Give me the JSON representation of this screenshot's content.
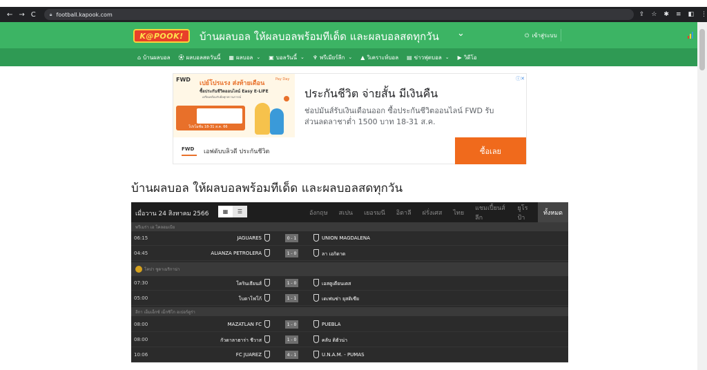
{
  "browser": {
    "url": "football.kapook.com"
  },
  "header": {
    "logo_text": "K@POOK!",
    "title": "บ้านผลบอล ให้ผลบอลพร้อมทีเด็ด และผลบอลสดทุกวัน",
    "login_label": "เข้าสู่ระบบ"
  },
  "nav": {
    "items": [
      {
        "label": "บ้านผลบอล",
        "icon": "home-icon"
      },
      {
        "label": "ผลบอลสดวันนี้",
        "icon": "ball-icon"
      },
      {
        "label": "ผลบอล",
        "icon": "grid-icon",
        "dropdown": true
      },
      {
        "label": "บอลวันนี้",
        "icon": "calendar-icon",
        "dropdown": true
      },
      {
        "label": "พรีเมียร์ลีก",
        "icon": "trophy-icon",
        "dropdown": true
      },
      {
        "label": "วิเคราะห์บอล",
        "icon": "chart-icon"
      },
      {
        "label": "ข่าวฟุตบอล",
        "icon": "news-icon",
        "dropdown": true
      },
      {
        "label": "วิดีโอ",
        "icon": "video-icon"
      }
    ]
  },
  "ad": {
    "brand": "FWD",
    "promo_title": "เปย์โปรแรง ส่งท้ายเดือน",
    "payday": "Pay Day",
    "promo_sub": "ซื้อประกันชีวิตออนไลน์ Easy E-LIFE",
    "promo_small": "เตรียมพร้อมรับมือทุกสถานการณ์",
    "promo_date": "โปรโมชั่น 18-31 ส.ค. 66",
    "headline": "ประกันชีวิต จ่ายสั้น มีเงินคืน",
    "body": "ช่อปมันส์รับเงินเดือนออก ซื้อประกันชีวิตออนไลน์ FWD รับส่วนลดลาชาต่ำ 1500 บาท 18-31 ส.ค.",
    "advertiser": "เอฟดับบลิวดี ประกันชีวิต",
    "cta": "ซื้อเลย"
  },
  "page": {
    "title": "บ้านผลบอล ให้ผลบอลพร้อมทีเด็ด และผลบอลสดทุกวัน"
  },
  "results": {
    "date_label": "เมื่อวาน 24 สิงหาคม 2566",
    "leagues": [
      "อังกฤษ",
      "สเปน",
      "เยอรมนี",
      "อิตาลี",
      "ฝรั่งเศส",
      "ไทย",
      "แชมเปี้ยนส์ลีก",
      "ยูโรป้า",
      "ทั้งหมด"
    ],
    "active_league": "ทั้งหมด",
    "groups": [
      {
        "name": "พรีเมร่า เอ โคลอมเบีย",
        "matches": [
          {
            "time": "06:15",
            "home": "JAGUARES",
            "score": "0 - 1",
            "away": "UNION MAGDALENA"
          },
          {
            "time": "04:45",
            "home": "ALIANZA PETROLERA",
            "score": "1 - 0",
            "away": "ลา เอกิดาด"
          }
        ]
      },
      {
        "name": "โคปา ซูดาเมริกาน่า",
        "matches": [
          {
            "time": "07:30",
            "home": "โครินเธียนส์",
            "score": "1 - 0",
            "away": "เอสตูเดียนเตส"
          },
          {
            "time": "05:00",
            "home": "โบตาโฟโก้",
            "score": "1 - 1",
            "away": "เดเฟนซ่า ยุสติเซีย"
          }
        ]
      },
      {
        "name": "ลีกา เอ็มเอ็กซ์ เม็กซิโก อเปอร์ตูร่า",
        "matches": [
          {
            "time": "08:00",
            "home": "MAZATLAN FC",
            "score": "1 - 0",
            "away": "PUEBLA"
          },
          {
            "time": "08:00",
            "home": "กัวดาลาฮาร่า ชีวาส",
            "score": "1 - 0",
            "away": "คลับ ติฮัวน่า"
          },
          {
            "time": "10:06",
            "home": "FC JUAREZ",
            "score": "4 - 1",
            "away": "U.N.A.M. - PUMAS"
          }
        ]
      }
    ]
  }
}
